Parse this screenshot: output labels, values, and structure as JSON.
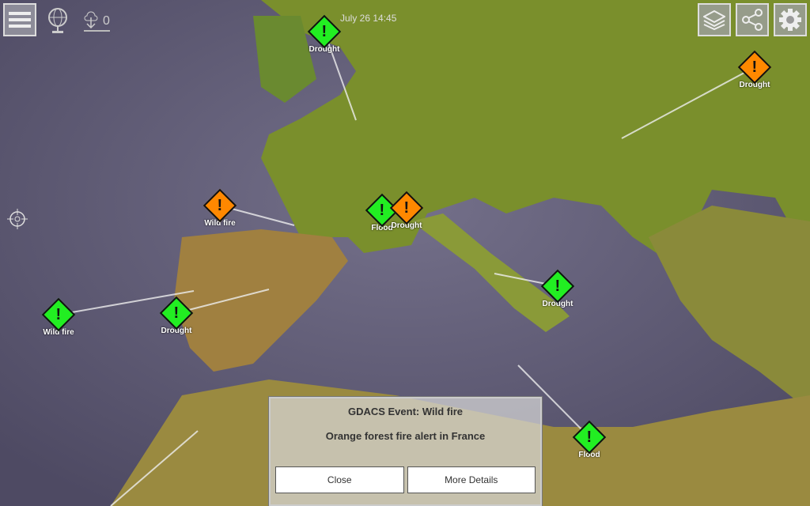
{
  "header": {
    "timestamp": "July 26 14:45",
    "download_count": "0"
  },
  "colors": {
    "green": "#22ee22",
    "orange": "#ff8800"
  },
  "markers": [
    {
      "label": "Drought",
      "level": "green"
    },
    {
      "label": "Drought",
      "level": "orange"
    },
    {
      "label": "Wild fire",
      "level": "orange"
    },
    {
      "label": "Flood",
      "level": "green"
    },
    {
      "label": "Drought",
      "level": "orange"
    },
    {
      "label": "Wild fire",
      "level": "green"
    },
    {
      "label": "Drought",
      "level": "green"
    },
    {
      "label": "Drought",
      "level": "green"
    },
    {
      "label": "Flood",
      "level": "green"
    }
  ],
  "popup": {
    "title": "GDACS Event: Wild fire",
    "message": "Orange forest fire alert in France",
    "close_label": "Close",
    "details_label": "More Details"
  }
}
